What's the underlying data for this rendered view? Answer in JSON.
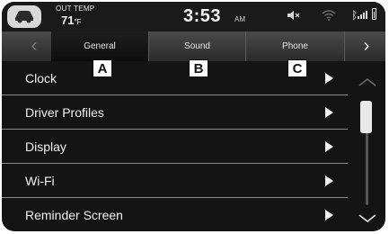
{
  "status": {
    "temp_label": "OUT TEMP",
    "temp_value": "71",
    "temp_unit": "°F",
    "time": "3:53",
    "ampm": "AM"
  },
  "tabs": [
    {
      "label": "General",
      "selected": true
    },
    {
      "label": "Sound",
      "selected": false
    },
    {
      "label": "Phone",
      "selected": false
    }
  ],
  "nav": {
    "prev": "‹",
    "next": "›"
  },
  "menu": [
    {
      "label": "Clock"
    },
    {
      "label": "Driver Profiles"
    },
    {
      "label": "Display"
    },
    {
      "label": "Wi-Fi"
    },
    {
      "label": "Reminder Screen"
    }
  ],
  "callouts": [
    "A",
    "B",
    "C"
  ],
  "colors": {
    "background": "#141414",
    "tab_selected": "#0e0e0e",
    "text": "#f2f2f2"
  }
}
